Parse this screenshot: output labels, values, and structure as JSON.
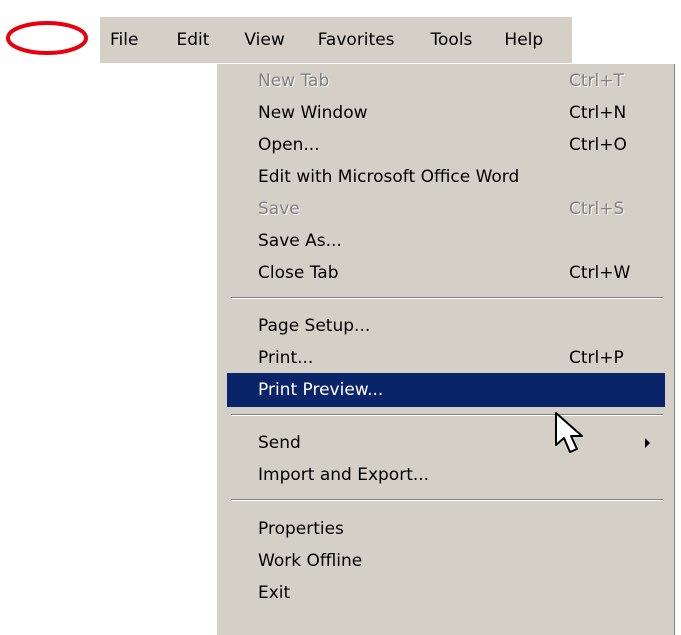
{
  "annotation": {
    "ellipse_color": "#e8000d"
  },
  "menubar": {
    "items": [
      "File",
      "Edit",
      "View",
      "Favorites",
      "Tools",
      "Help"
    ]
  },
  "file_menu": {
    "items": [
      {
        "label": "New Tab",
        "shortcut": "Ctrl+T",
        "disabled": true
      },
      {
        "label": "New Window",
        "shortcut": "Ctrl+N"
      },
      {
        "label": "Open...",
        "shortcut": "Ctrl+O"
      },
      {
        "label": "Edit with Microsoft Office Word",
        "shortcut": ""
      },
      {
        "label": "Save",
        "shortcut": "Ctrl+S",
        "disabled": true
      },
      {
        "label": "Save As...",
        "shortcut": ""
      },
      {
        "label": "Close Tab",
        "shortcut": "Ctrl+W"
      },
      {
        "label": "Page Setup...",
        "shortcut": ""
      },
      {
        "label": "Print...",
        "shortcut": "Ctrl+P"
      },
      {
        "label": "Print Preview...",
        "shortcut": "",
        "highlighted": true
      },
      {
        "label": "Send",
        "shortcut": "",
        "submenu": true
      },
      {
        "label": "Import and Export...",
        "shortcut": ""
      },
      {
        "label": "Properties",
        "shortcut": ""
      },
      {
        "label": "Work Offline",
        "shortcut": ""
      },
      {
        "label": "Exit",
        "shortcut": ""
      }
    ]
  },
  "colors": {
    "menu_bg": "#d4d0c8",
    "highlight_bg": "#0a246a",
    "highlight_text": "#ffffff",
    "disabled_text": "#808080"
  }
}
